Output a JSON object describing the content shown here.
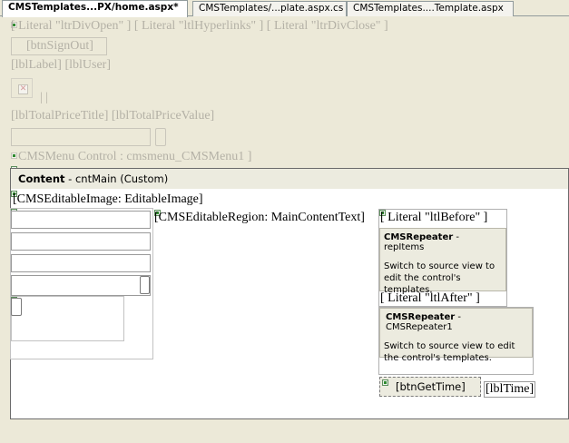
{
  "tabs": [
    {
      "label": "CMSTemplates...PX/home.aspx*"
    },
    {
      "label": "CMSTemplates/...plate.aspx.cs"
    },
    {
      "label": "CMSTemplates....Template.aspx"
    }
  ],
  "master": {
    "literals_row": "[ Literal \"ltrDivOpen\" ] [ Literal \"ltlHyperlinks\" ] [ Literal \"ltrDivClose\" ]",
    "signout_button": "[btnSignOut]",
    "label_row": "[lblLabel]  [lblUser]",
    "pipes": "|   |",
    "price_row": "[lblTotalPriceTitle] [lblTotalPriceValue]",
    "menu_row": "CMSMenu Control : cmsmenu_CMSMenu1 ]"
  },
  "content": {
    "header_bold": "Content",
    "header_rest": " - cntMain (Custom)",
    "editable_image": "[CMSEditableImage: EditableImage]",
    "editable_region": "[CMSEditableRegion: MainContentText]",
    "literal_before": "[ Literal \"ltlBefore\" ]",
    "repeater1_title": "CMSRepeater",
    "repeater1_id": " - repItems",
    "repeater1_desc": "Switch to source view to edit the control's templates.",
    "literal_after": "[ Literal \"ltlAfter\" ]",
    "repeater2_title": "CMSRepeater",
    "repeater2_id": " - CMSRepeater1",
    "repeater2_desc": "Switch to source view to edit the control's templates.",
    "get_time_button": "[btnGetTime]",
    "time_label": "[lblTime]"
  }
}
